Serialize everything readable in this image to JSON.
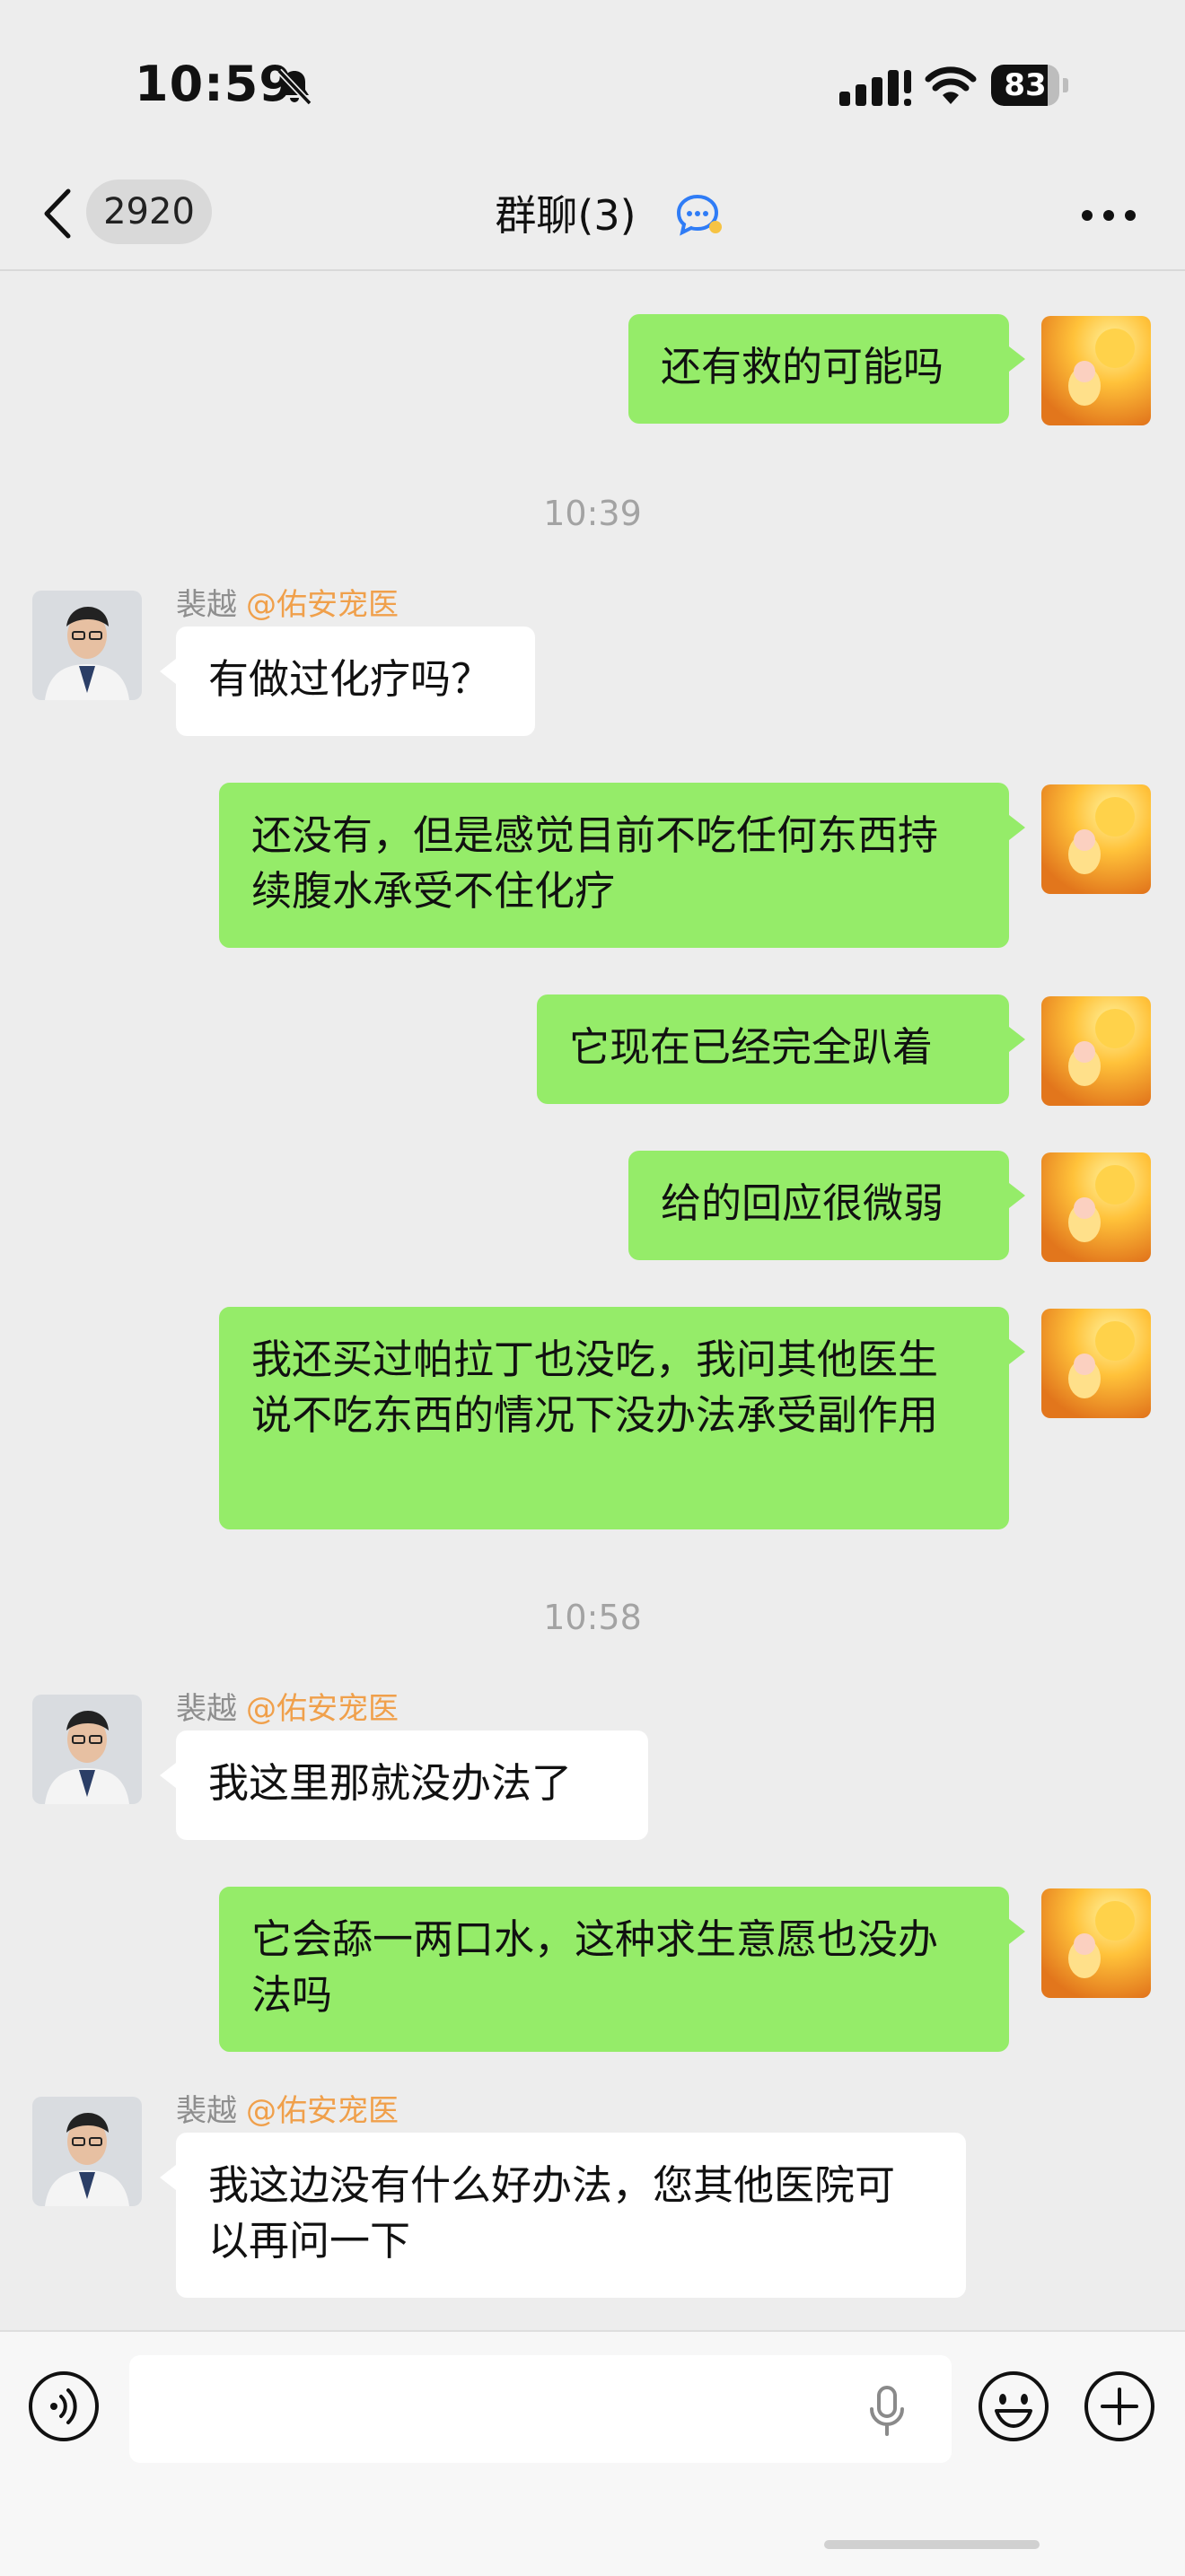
{
  "status_bar": {
    "time": "10:59",
    "battery": "83",
    "battery_level": 0.83
  },
  "nav": {
    "back_count": "2920",
    "title": "群聊(3)"
  },
  "messages": [
    {
      "text": "还有救的可能吗"
    },
    {
      "time": "10:39"
    },
    {
      "sender": "裴越",
      "org": "@佑安宠医",
      "text": "有做过化疗吗？"
    },
    {
      "text": "还没有，但是感觉目前不吃任何东西持续腹水承受不住化疗"
    },
    {
      "text": "它现在已经完全趴着"
    },
    {
      "text": "给的回应很微弱"
    },
    {
      "text": "我还买过帕拉丁也没吃，我问其他医生说不吃东西的情况下没办法承受副作用"
    },
    {
      "time": "10:58"
    },
    {
      "sender": "裴越",
      "org": "@佑安宠医",
      "text": "我这里那就没办法了"
    },
    {
      "text": "它会舔一两口水，这种求生意愿也没办法吗"
    },
    {
      "sender": "裴越",
      "org": "@佑安宠医",
      "text": "我这边没有什么好办法，您其他医院可以再问一下"
    }
  ],
  "colors": {
    "sent_bubble": "#95ec69",
    "received_bubble": "#ffffff",
    "background": "#ededed",
    "org_tag": "#f0a04b"
  },
  "icons": {
    "status": [
      "bell-slash-icon",
      "cellular-signal-icon",
      "wifi-icon",
      "battery-icon"
    ],
    "nav": [
      "chevron-left-icon",
      "group-chat-icon",
      "more-dots-icon"
    ],
    "input": [
      "voice-icon",
      "microphone-icon",
      "emoji-icon",
      "plus-icon"
    ]
  }
}
